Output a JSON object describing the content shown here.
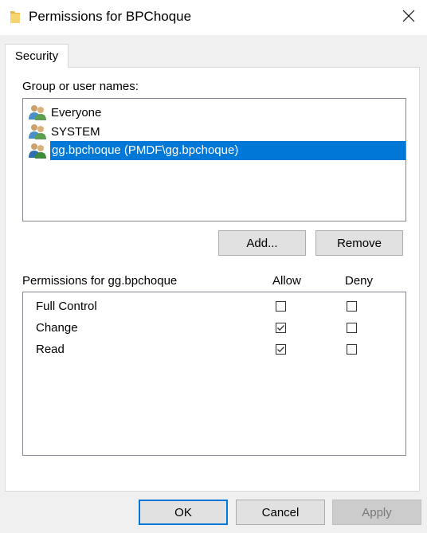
{
  "window": {
    "title": "Permissions for BPChoque",
    "folder_icon": "folder-icon",
    "close_icon": "close-icon"
  },
  "tabs": [
    {
      "label": "Security",
      "active": true
    }
  ],
  "users_section": {
    "label": "Group or user names:",
    "users": [
      {
        "name": "Everyone",
        "icon": "user-group-icon",
        "selected": false
      },
      {
        "name": "SYSTEM",
        "icon": "user-group-icon",
        "selected": false
      },
      {
        "name": "gg.bpchoque (PMDF\\gg.bpchoque)",
        "icon": "user-group-icon",
        "selected": true
      }
    ]
  },
  "buttons": {
    "add": "Add...",
    "remove": "Remove",
    "ok": "OK",
    "cancel": "Cancel",
    "apply": "Apply"
  },
  "permissions_section": {
    "label": "Permissions for gg.bpchoque",
    "allow_header": "Allow",
    "deny_header": "Deny",
    "rows": [
      {
        "name": "Full Control",
        "allow": false,
        "deny": false
      },
      {
        "name": "Change",
        "allow": true,
        "deny": false
      },
      {
        "name": "Read",
        "allow": true,
        "deny": false
      }
    ]
  },
  "colors": {
    "selection": "#0078d7",
    "default_button_border": "#0078d7",
    "dialog_background": "#f0f0f0"
  }
}
